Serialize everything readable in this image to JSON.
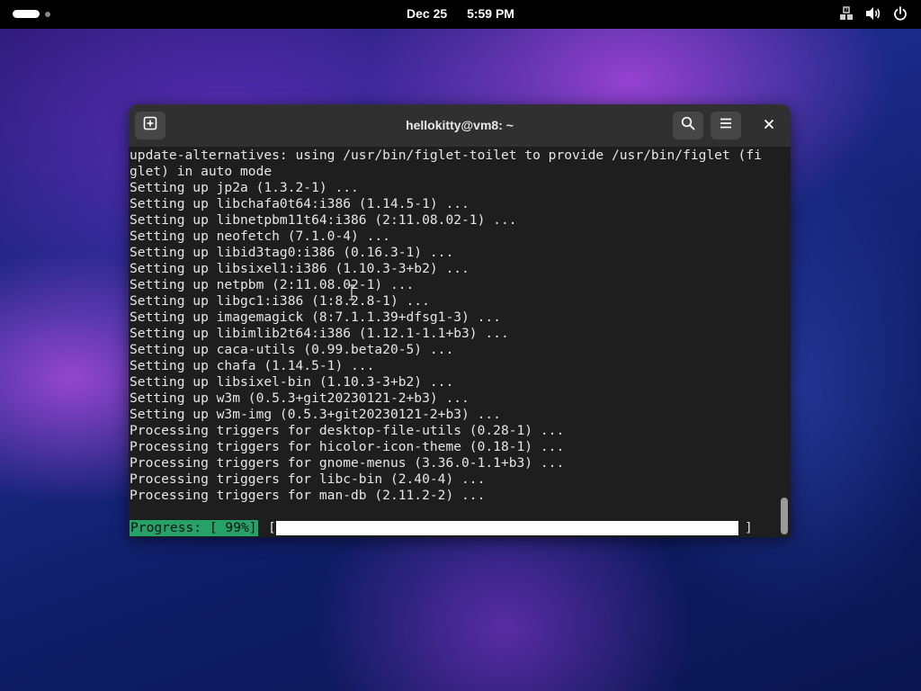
{
  "topbar": {
    "date": "Dec 25",
    "time": "5:59 PM",
    "icons": [
      "activities-indicator",
      "accessibility-icon",
      "volume-icon",
      "power-icon"
    ]
  },
  "window": {
    "title": "hellokitty@vm8: ~",
    "buttons": [
      "new-tab-icon",
      "search-icon",
      "menu-icon",
      "close-icon"
    ]
  },
  "terminal": {
    "lines": [
      "update-alternatives: using /usr/bin/figlet-toilet to provide /usr/bin/figlet (fi",
      "glet) in auto mode",
      "Setting up jp2a (1.3.2-1) ...",
      "Setting up libchafa0t64:i386 (1.14.5-1) ...",
      "Setting up libnetpbm11t64:i386 (2:11.08.02-1) ...",
      "Setting up neofetch (7.1.0-4) ...",
      "Setting up libid3tag0:i386 (0.16.3-1) ...",
      "Setting up libsixel1:i386 (1.10.3-3+b2) ...",
      "Setting up netpbm (2:11.08.02-1) ...",
      "Setting up libgc1:i386 (1:8.2.8-1) ...",
      "Setting up imagemagick (8:7.1.1.39+dfsg1-3) ...",
      "Setting up libimlib2t64:i386 (1.12.1-1.1+b3) ...",
      "Setting up caca-utils (0.99.beta20-5) ...",
      "Setting up chafa (1.14.5-1) ...",
      "Setting up libsixel-bin (1.10.3-3+b2) ...",
      "Setting up w3m (0.5.3+git20230121-2+b3) ...",
      "Setting up w3m-img (0.5.3+git20230121-2+b3) ...",
      "Processing triggers for desktop-file-utils (0.28-1) ...",
      "Processing triggers for hicolor-icon-theme (0.18-1) ...",
      "Processing triggers for gnome-menus (3.36.0-1.1+b3) ...",
      "Processing triggers for libc-bin (2.40-4) ...",
      "Processing triggers for man-db (2.11.2-2) ..."
    ],
    "progress_label": "Progress: [ 99%]",
    "bracket_open": "[",
    "bracket_close": "]",
    "progress_fraction": 0.99
  },
  "colors": {
    "progress_label_bg": "#26a269",
    "terminal_bg": "#1e1e1e",
    "titlebar_bg": "#303030"
  }
}
